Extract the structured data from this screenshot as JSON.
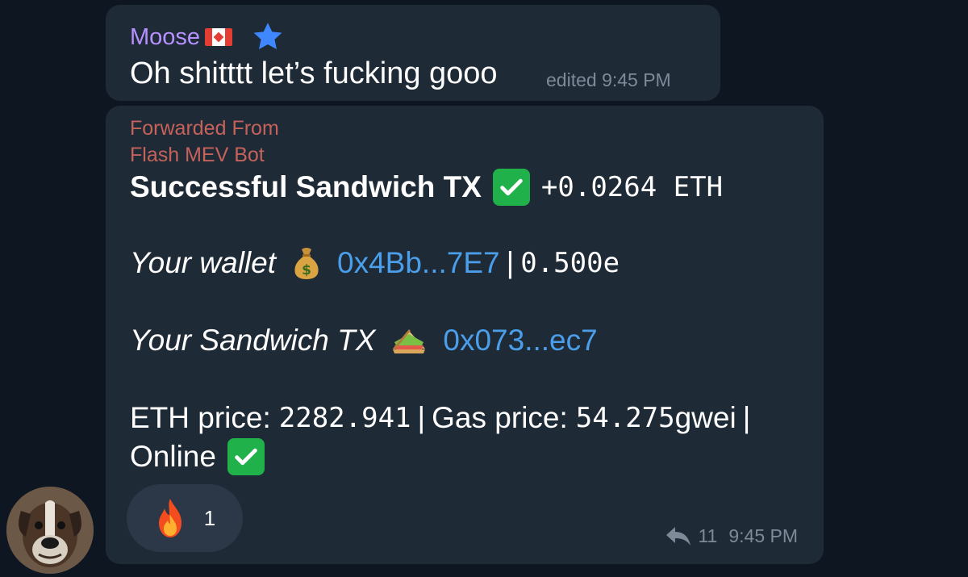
{
  "messages": [
    {
      "sender": "Moose",
      "text": "Oh shitttt let’s fucking gooo",
      "edited_label": "edited",
      "time": "9:45 PM"
    },
    {
      "forwarded_label": "Forwarded From",
      "forwarded_from": "Flash MEV Bot",
      "title": "Successful Sandwich TX",
      "profit": "+0.0264 ETH",
      "wallet_label": "Your wallet",
      "wallet_address": "0x4Bb...7E7",
      "separator": "|",
      "wallet_balance": "0.500e",
      "tx_label": "Your Sandwich TX",
      "tx_hash": "0x073...ec7",
      "eth_price_label": "ETH price:",
      "eth_price_value": "2282.941",
      "gas_price_label": "Gas price:",
      "gas_price_value": "54.275",
      "gas_unit": "gwei",
      "status": "Online",
      "reaction_emoji": "fire-icon",
      "reaction_count": "1",
      "share_count": "11",
      "time": "9:45 PM"
    }
  ],
  "icons": {
    "star": "star-icon",
    "flag": "canada-flag-icon",
    "check": "check-mark-icon",
    "money_bag": "money-bag-icon",
    "sandwich": "sandwich-icon",
    "share": "share-icon",
    "avatar": "dog-avatar"
  },
  "colors": {
    "background": "#0e1621",
    "bubble": "#1f2a37",
    "sender": "#b691ff",
    "forward": "#c5625a",
    "link": "#4b9eea",
    "meta": "#7e8a98"
  }
}
